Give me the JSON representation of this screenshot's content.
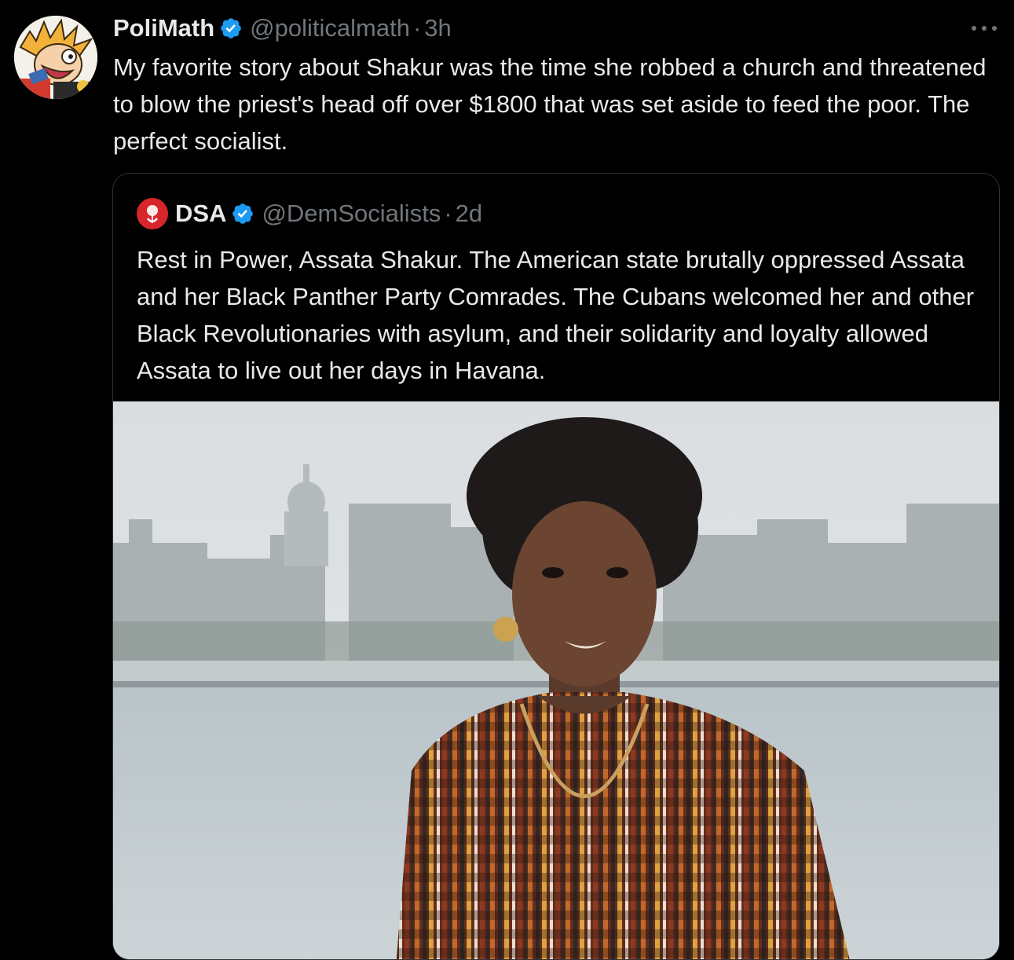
{
  "tweet": {
    "display_name": "PoliMath",
    "handle": "@politicalmath",
    "separator": "·",
    "time": "3h",
    "text": "My favorite story about Shakur was the time she robbed a church and threatened to blow the priest's head off over $1800 that was set aside to feed the poor. The perfect socialist.",
    "avatar_icon": "calvin-cartoon-avatar",
    "verified_icon": "verified-badge-icon",
    "more_icon": "more-options-icon"
  },
  "quote": {
    "display_name": "DSA",
    "handle": "@DemSocialists",
    "separator": "·",
    "time": "2d",
    "text": "Rest in Power, Assata Shakur. The American state brutally oppressed Assata and her Black Panther Party Comrades. The Cubans welcomed her and other Black Revolutionaries with asylum, and their solidarity and loyalty allowed Assata to live out her days in Havana.",
    "avatar_icon": "dsa-rose-logo",
    "media_description": "photo"
  },
  "colors": {
    "background": "#000000",
    "primary_text": "#e7e9ea",
    "secondary_text": "#71767b",
    "border": "#2f3336",
    "verified_blue": "#1d9bf0",
    "dsa_red": "#d7262b"
  }
}
